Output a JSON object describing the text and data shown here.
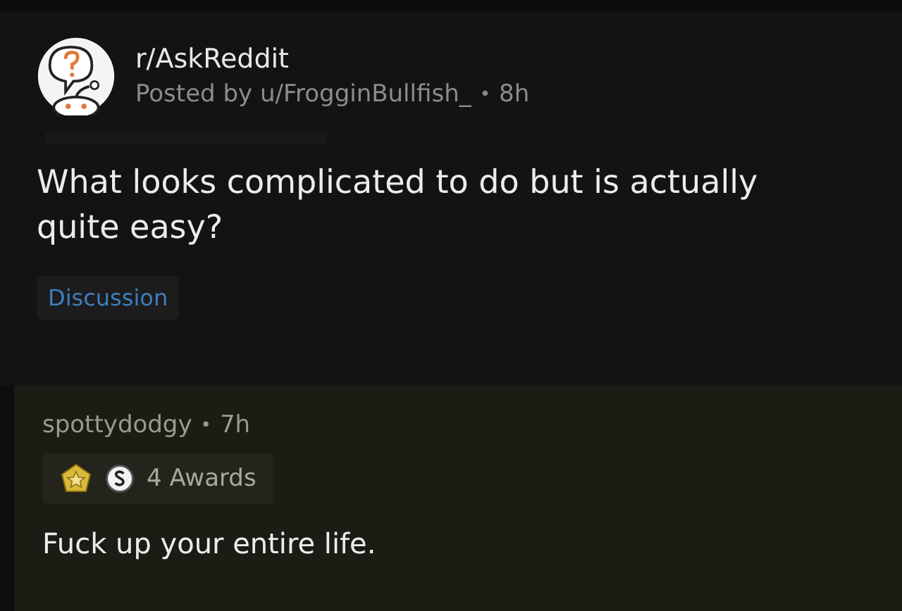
{
  "post": {
    "subreddit": "r/AskReddit",
    "posted_by": "Posted by u/FrogginBullfish_",
    "separator": "•",
    "age": "8h",
    "title": "What looks complicated to do but is actually quite easy?",
    "flair": "Discussion"
  },
  "comment": {
    "author": "spottydodgy",
    "separator": "•",
    "age": "7h",
    "awards": "4 Awards",
    "body": "Fuck up your entire life."
  }
}
